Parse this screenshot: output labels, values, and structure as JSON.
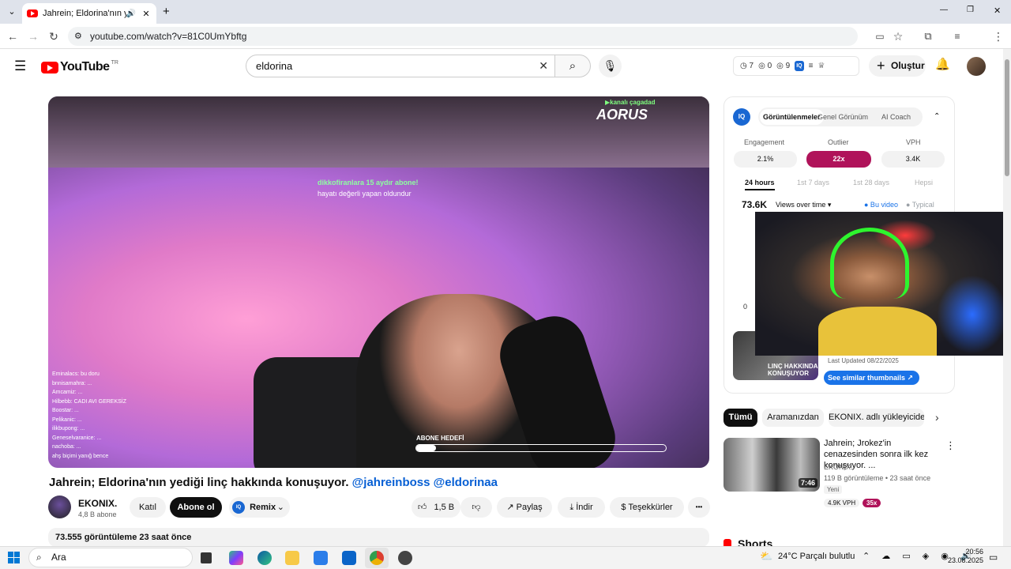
{
  "browser": {
    "tab_title": "Jahrein; Eldorina'nın yediği",
    "tab_close": "✕",
    "new_tab": "+",
    "url": "youtube.com/watch?v=81C0UmYbftg",
    "back": "←",
    "forward": "→",
    "reload": "↻",
    "win_min": "—",
    "win_max": "❐",
    "win_close": "✕"
  },
  "youtube": {
    "logo_text": "YouTube",
    "logo_country": "TR",
    "search_value": "eldorina",
    "search_clear": "✕",
    "search_icon": "⌕",
    "mic_icon": "🎙",
    "counters": [
      "◷ 7",
      "◎ 0",
      "◎ 9",
      "IQ",
      "≡",
      "♕"
    ],
    "create_label": "Oluştur",
    "bell": "🔔"
  },
  "video": {
    "channel_tag": "▶kanalı çagadad",
    "brand": "AORUS",
    "sub_banner": "dikkofiranlara 15 aydır abone!",
    "sub_banner2": "hayatı değerli yapan oldundur",
    "chat": [
      "Eminalacs: bu doru",
      "bnnisamahra: ...",
      "Amcamiz: ...",
      "Hilbebb: CADI AVI GEREKSİZ",
      "Boostar: ...",
      "Pelikanic: ...",
      "ilikbupong: ...",
      "Geneselvaranice: ...",
      "nachoba: ...",
      "ahş biçimi yanığ bence"
    ],
    "goal_label": "ABONE HEDEFİ",
    "goal_progress": 0.08,
    "title_plain": "Jahrein; Eldorina'nın yediği linç hakkında konuşuyor.",
    "title_tags": "@jahreinboss @eldorinaa",
    "channel_name": "EKONIX.",
    "channel_subs": "4,8 B abone",
    "join_label": "Katıl",
    "subscribe_label": "Abone ol",
    "remix_label": "Remix",
    "likes": "1,5 B",
    "share_label": "Paylaş",
    "download_label": "İndir",
    "thanks_label": "Teşekkürler",
    "more_label": "•••",
    "views_line": "73.555 görüntüleme  23 saat önce"
  },
  "card": {
    "tabs": [
      "Görüntülenmeler",
      "Genel Görünüm",
      "AI Coach"
    ],
    "collapse": "⌃",
    "stats": [
      {
        "label": "Engagement",
        "value": "2.1%"
      },
      {
        "label": "Outlier",
        "value": "22x"
      },
      {
        "label": "VPH",
        "value": "3.4K"
      }
    ],
    "ranges": [
      "24 hours",
      "1st 7 days",
      "1st 28 days",
      "Hepsi"
    ],
    "views_total": "73.6K",
    "views_select": "Views over time ▾",
    "legend_this": "● Bu video",
    "legend_typical": "● Typical",
    "y_zero": "0",
    "thumb_text": "LINÇ HAKKINDA KONUŞUYOR",
    "last_updated": "Last Updated 08/22/2025",
    "see_similar": "See similar thumbnails ↗"
  },
  "chips": [
    "Tümü",
    "Aramanızdan",
    "EKONIX. adlı yükleyiciden"
  ],
  "chip_next": "›",
  "recommended": {
    "title": "Jahrein; Jrokez'in cenazesinden sonra ilk kez konuşuyor. ...",
    "channel": "EKONIX.",
    "meta": "119 B görüntüleme • 23 saat önce",
    "new_badge": "Yeni",
    "duration": "7:46",
    "vph": "4.9K VPH",
    "multiplier": "35x",
    "menu": "⋮"
  },
  "shorts_label": "Shorts",
  "taskbar": {
    "search": "Ara",
    "weather": "24°C  Parçalı bulutlu",
    "tray": "⌃ ☁ ▭ ◈ ◉ 🔊",
    "time": "20:56",
    "date": "23.08.2025"
  },
  "colors": {
    "youtube_red": "#ff0000",
    "outlier_pink": "#b0135a",
    "iq_blue": "#1967d2",
    "link_blue": "#065fd4"
  }
}
